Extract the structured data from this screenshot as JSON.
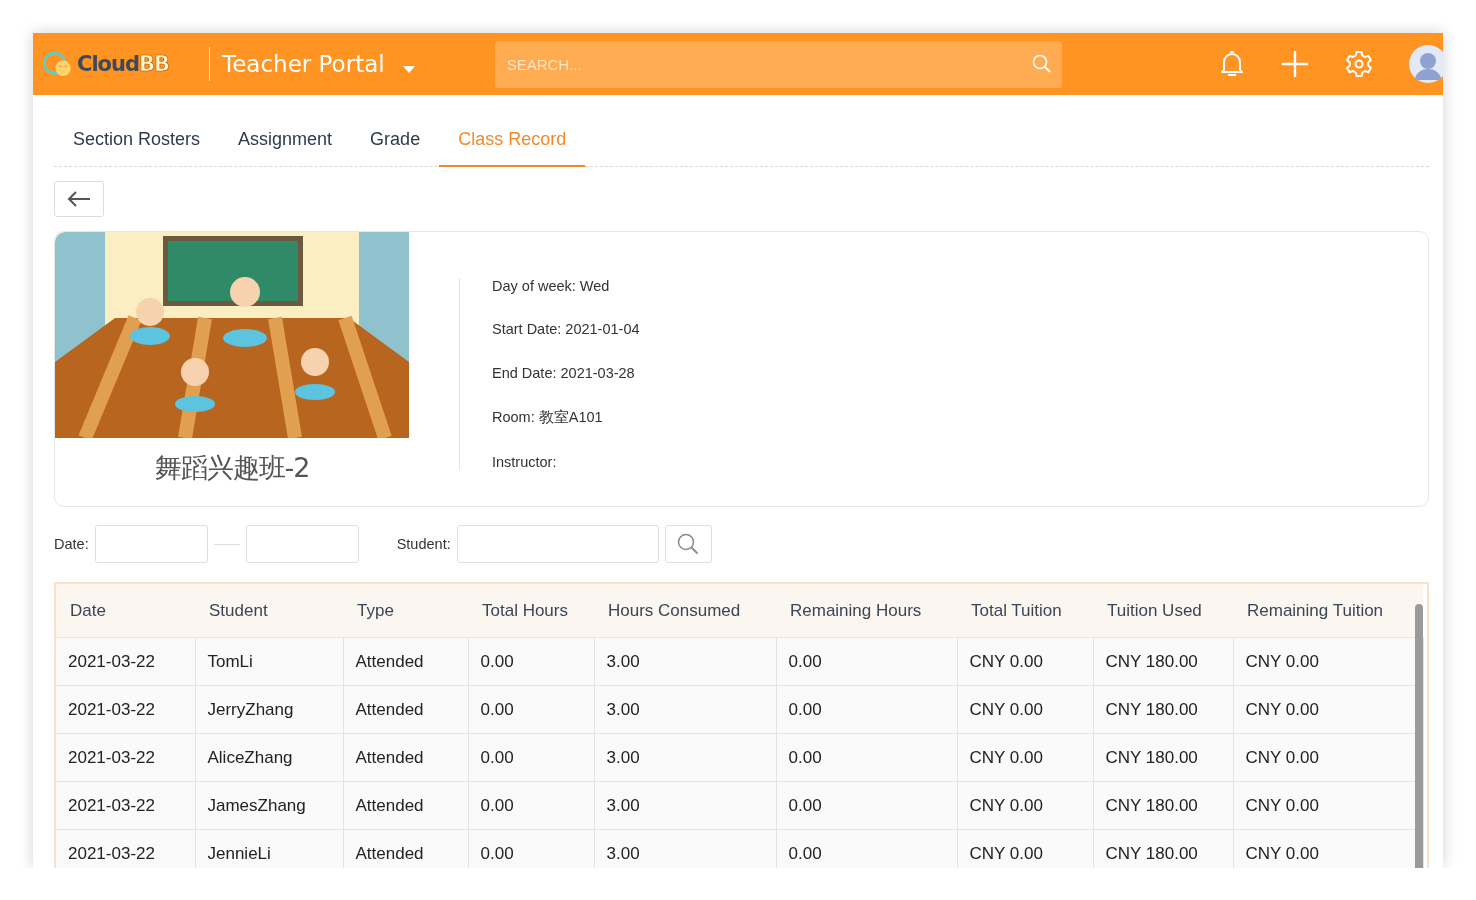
{
  "header": {
    "logo": {
      "main": "Cloud",
      "accent": "BB"
    },
    "portal": "Teacher Portal",
    "search": {
      "placeholder": "SEARCH..."
    }
  },
  "tabs": [
    {
      "label": "Section Rosters",
      "selected": false
    },
    {
      "label": "Assignment",
      "selected": false
    },
    {
      "label": "Grade",
      "selected": false
    },
    {
      "label": "Class Record",
      "selected": true
    }
  ],
  "class_card": {
    "name": "舞蹈兴趣班-2",
    "details": [
      "Day of week: Wed",
      "Start Date: 2021-01-04",
      "End Date: 2021-03-28",
      "Room: 教室A101",
      "Instructor:"
    ]
  },
  "filters": {
    "date_label": "Date:",
    "student_label": "Student:"
  },
  "table": {
    "columns": [
      "Date",
      "Student",
      "Type",
      "Total Hours",
      "Hours Consumed",
      "Remaining Hours",
      "Total Tuition",
      "Tuition Used",
      "Remaining Tuition"
    ],
    "rows": [
      [
        "2021-03-22",
        "TomLi",
        "Attended",
        "0.00",
        "3.00",
        "0.00",
        "CNY 0.00",
        "CNY 180.00",
        "CNY 0.00"
      ],
      [
        "2021-03-22",
        "JerryZhang",
        "Attended",
        "0.00",
        "3.00",
        "0.00",
        "CNY 0.00",
        "CNY 180.00",
        "CNY 0.00"
      ],
      [
        "2021-03-22",
        "AliceZhang",
        "Attended",
        "0.00",
        "3.00",
        "0.00",
        "CNY 0.00",
        "CNY 180.00",
        "CNY 0.00"
      ],
      [
        "2021-03-22",
        "JamesZhang",
        "Attended",
        "0.00",
        "3.00",
        "0.00",
        "CNY 0.00",
        "CNY 180.00",
        "CNY 0.00"
      ],
      [
        "2021-03-22",
        "JennieLi",
        "Attended",
        "0.00",
        "3.00",
        "0.00",
        "CNY 0.00",
        "CNY 180.00",
        "CNY 0.00"
      ]
    ]
  }
}
